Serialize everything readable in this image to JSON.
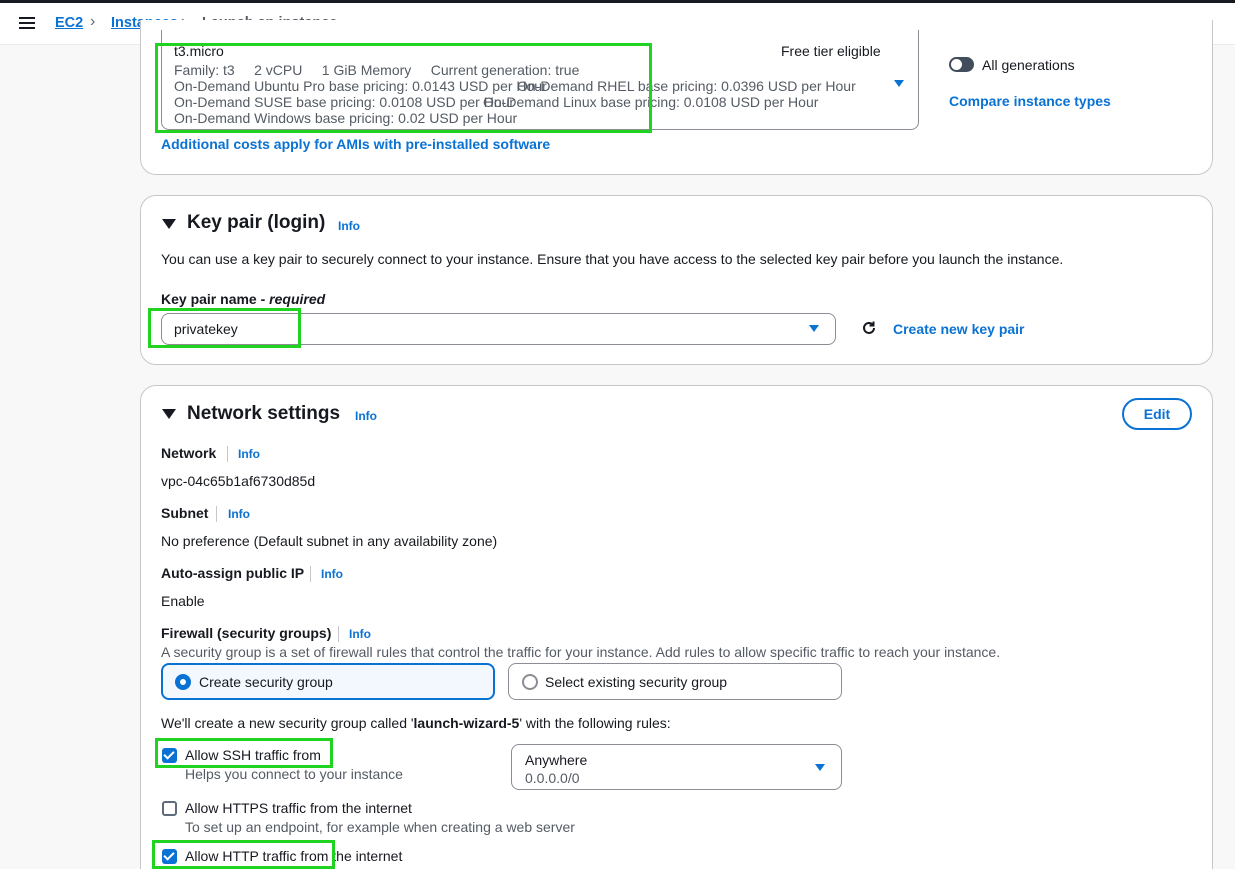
{
  "breadcrumb": {
    "ec2": "EC2",
    "instances": "Instances",
    "current": "Launch an instance"
  },
  "instance_type": {
    "name": "t3.micro",
    "free_tier": "Free tier eligible",
    "family_line": "Family: t3     2 vCPU     1 GiB Memory     Current generation: true",
    "pricing_1": "On-Demand Ubuntu Pro base pricing: 0.0143 USD per Hour",
    "pricing_2": "On-Demand RHEL base pricing: 0.0396 USD per Hour",
    "pricing_3": "On-Demand SUSE base pricing: 0.0108 USD per Hour",
    "pricing_4": "On-Demand Linux base pricing: 0.0108 USD per Hour",
    "pricing_5": "On-Demand Windows base pricing: 0.02 USD per Hour",
    "all_generations": "All generations",
    "compare": "Compare instance types",
    "additional_costs": "Additional costs apply for AMIs with pre-installed software"
  },
  "key_pair": {
    "title": "Key pair (login)",
    "info": "Info",
    "description": "You can use a key pair to securely connect to your instance. Ensure that you have access to the selected key pair before you launch the instance.",
    "field_label": "Key pair name - ",
    "required": "required",
    "value": "privatekey",
    "create": "Create new key pair"
  },
  "network": {
    "title": "Network settings",
    "info": "Info",
    "edit": "Edit",
    "network_label": "Network",
    "network_value": "vpc-04c65b1af6730d85d",
    "subnet_label": "Subnet",
    "subnet_value": "No preference (Default subnet in any availability zone)",
    "public_ip_label": "Auto-assign public IP",
    "public_ip_value": "Enable",
    "firewall_label": "Firewall (security groups)",
    "firewall_desc": "A security group is a set of firewall rules that control the traffic for your instance. Add rules to allow specific traffic to reach your instance.",
    "create_sg": "Create security group",
    "select_sg": "Select existing security group",
    "sg_intro_prefix": "We'll create a new security group called '",
    "sg_name": "launch-wizard-5",
    "sg_intro_suffix": "' with the following rules:",
    "ssh_label": "Allow SSH traffic from",
    "ssh_help": "Helps you connect to your instance",
    "ssh_source": "Anywhere",
    "ssh_cidr": "0.0.0.0/0",
    "https_label": "Allow HTTPS traffic from the internet",
    "https_help": "To set up an endpoint, for example when creating a web server",
    "http_label": "Allow HTTP traffic from the internet"
  },
  "colors": {
    "accent": "#0972d3",
    "highlight": "#21d321"
  },
  "icons": {
    "menu": "hamburger-icon",
    "refresh": "refresh-icon"
  }
}
